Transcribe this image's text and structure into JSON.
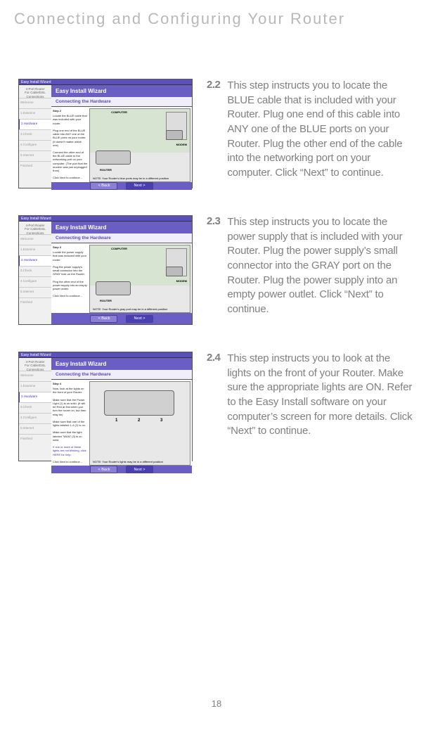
{
  "page": {
    "title": "Connecting and Configuring Your Router",
    "number": "18"
  },
  "wizard": {
    "window_title": "Easy Install Wizard",
    "panel_title": "Easy Install Wizard",
    "subtitle": "Connecting the Hardware",
    "logo": "4-Port Router",
    "logo_sub": "For Cable/DSL Connections",
    "back_btn": "< Back",
    "next_btn": "Next >",
    "nav": [
      "Welcome",
      "1.Examine",
      "2.Hardware",
      "3.Check",
      "4.Configure",
      "5.Internet",
      "Finished"
    ]
  },
  "screenshot1": {
    "step_label": "Step 2",
    "para1": "Locate the BLUE cable that was included with your router.",
    "para2": "Plug one end of the BLUE cable into ANY one of the BLUE ports on your router. (It doesn't matter which one)",
    "para3": "Connect the other end of the BLUE cable to the networking port on your computer. (The port that the modem was just unplugged from)",
    "para4": "Click Next to continue...",
    "label_computer": "COMPUTER",
    "label_modem": "MODEM",
    "label_router": "ROUTER",
    "note": "NOTE: Your Router's blue ports may be in a different position"
  },
  "screenshot2": {
    "step_label": "Step 3",
    "para1": "Locate the power supply that was included with your router.",
    "para2": "Plug the power supply's small connector into the GRAY hole on the Router.",
    "para3": "Plug the other end of the power supply into an empty power outlet.",
    "para4": "Click Next to continue...",
    "label_computer": "COMPUTER",
    "label_modem": "MODEM",
    "label_router": "ROUTER",
    "note": "NOTE: Your Router's gray port may be in a different position"
  },
  "screenshot3": {
    "step_label": "Step 4",
    "para1": "Now, look at the lights on the front of your Router.",
    "para2": "Make sure that the Power Light (1) is on solid. (It will be Red at first when you turn the router on, but then may be)",
    "para3": "Make sure that one of the lights labeled 1-4 (2) is on.",
    "para4": "Make sure that the light labeled \"WAN\" (3) is on solid.",
    "para5": "If one or more of these lights are not blinking, click HERE for help.",
    "para6": "Click Next to continue...",
    "note": "NOTE: Your Router's lights may be in a different position",
    "num1": "1",
    "num2": "2",
    "num3": "3"
  },
  "step22": {
    "num": "2.2",
    "text": "This step instructs you to locate the BLUE cable that is included with your Router. Plug one end of this cable into ANY one of the BLUE ports on your Router. Plug the other end of the cable into the networking port on your computer. Click “Next” to continue."
  },
  "step23": {
    "num": "2.3",
    "text": "This step instructs you to locate the power supply that is included with your Router. Plug the power supply’s small connector into the GRAY port on the Router. Plug the power supply into an empty power outlet. Click “Next” to continue."
  },
  "step24": {
    "num": "2.4",
    "text": "This step instructs you to look at the lights on the front of your Router. Make sure the appropriate lights are ON. Refer to the Easy Install software on your computer’s screen for more details. Click “Next” to continue."
  }
}
